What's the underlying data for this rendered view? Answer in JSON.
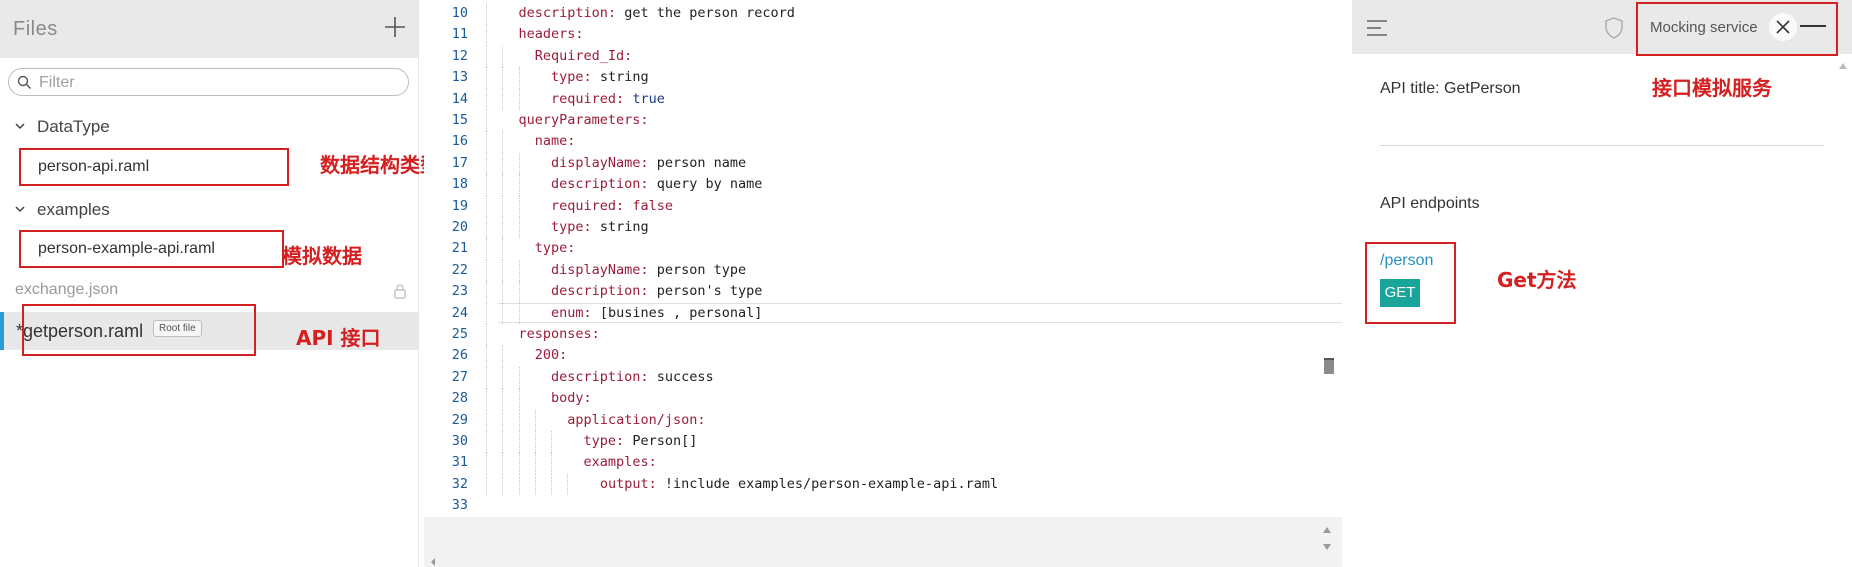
{
  "files_panel": {
    "title": "Files",
    "filter_placeholder": "Filter",
    "folders": [
      {
        "name": "DataType",
        "files": [
          "person-api.raml"
        ]
      },
      {
        "name": "examples",
        "files": [
          "person-example-api.raml"
        ]
      }
    ],
    "exchange_file": "exchange.json",
    "active_file": "*getperson.raml",
    "root_badge": "Root file"
  },
  "annotations": {
    "datatype": "数据结构类型",
    "mock_data": "模拟数据",
    "api": "API 接口",
    "mocking": "接口模拟服务",
    "get_method": "Get方法"
  },
  "editor": {
    "lines": [
      {
        "n": "10",
        "indent": 2,
        "parts": [
          [
            "k",
            "description: "
          ],
          [
            "t",
            "get the person record"
          ]
        ]
      },
      {
        "n": "11",
        "indent": 2,
        "parts": [
          [
            "k",
            "headers:"
          ]
        ]
      },
      {
        "n": "12",
        "indent": 3,
        "parts": [
          [
            "k",
            "Required_Id:"
          ]
        ]
      },
      {
        "n": "13",
        "indent": 4,
        "parts": [
          [
            "k",
            "type: "
          ],
          [
            "t",
            "string"
          ]
        ]
      },
      {
        "n": "14",
        "indent": 4,
        "parts": [
          [
            "k",
            "required: "
          ],
          [
            "b",
            "true"
          ]
        ]
      },
      {
        "n": "15",
        "indent": 2,
        "parts": [
          [
            "k",
            "queryParameters:"
          ]
        ]
      },
      {
        "n": "16",
        "indent": 3,
        "parts": [
          [
            "k",
            "name:"
          ]
        ]
      },
      {
        "n": "17",
        "indent": 4,
        "parts": [
          [
            "k",
            "displayName: "
          ],
          [
            "t",
            "person name"
          ]
        ]
      },
      {
        "n": "18",
        "indent": 4,
        "parts": [
          [
            "k",
            "description: "
          ],
          [
            "t",
            "query by name"
          ]
        ]
      },
      {
        "n": "19",
        "indent": 4,
        "parts": [
          [
            "k",
            "required: "
          ],
          [
            "f",
            "false"
          ]
        ]
      },
      {
        "n": "20",
        "indent": 4,
        "parts": [
          [
            "k",
            "type: "
          ],
          [
            "t",
            "string"
          ]
        ]
      },
      {
        "n": "21",
        "indent": 3,
        "parts": [
          [
            "k",
            "type:"
          ]
        ]
      },
      {
        "n": "22",
        "indent": 4,
        "parts": [
          [
            "k",
            "displayName: "
          ],
          [
            "t",
            "person type"
          ]
        ]
      },
      {
        "n": "23",
        "indent": 4,
        "parts": [
          [
            "k",
            "description: "
          ],
          [
            "t",
            "person's type"
          ]
        ]
      },
      {
        "n": "24",
        "indent": 4,
        "parts": [
          [
            "k",
            "enum: "
          ],
          [
            "t",
            "[busines , personal]"
          ]
        ]
      },
      {
        "n": "25",
        "indent": 2,
        "parts": [
          [
            "k",
            "responses:"
          ]
        ]
      },
      {
        "n": "26",
        "indent": 3,
        "parts": [
          [
            "k",
            "200:"
          ]
        ]
      },
      {
        "n": "27",
        "indent": 4,
        "parts": [
          [
            "k",
            "description: "
          ],
          [
            "t",
            "success"
          ]
        ]
      },
      {
        "n": "28",
        "indent": 4,
        "parts": [
          [
            "k",
            "body:"
          ]
        ]
      },
      {
        "n": "29",
        "indent": 5,
        "parts": [
          [
            "k",
            "application/json:"
          ]
        ]
      },
      {
        "n": "30",
        "indent": 6,
        "parts": [
          [
            "k",
            "type: "
          ],
          [
            "t",
            "Person[]"
          ]
        ]
      },
      {
        "n": "31",
        "indent": 6,
        "parts": [
          [
            "k",
            "examples:"
          ]
        ]
      },
      {
        "n": "32",
        "indent": 7,
        "parts": [
          [
            "k",
            "output: "
          ],
          [
            "i",
            "!include "
          ],
          [
            "t",
            "examples/person-example-api.raml"
          ]
        ]
      },
      {
        "n": "33",
        "indent": 0,
        "parts": []
      }
    ]
  },
  "right_panel": {
    "mocking_label": "Mocking service",
    "api_title": "API title: GetPerson",
    "endpoints_label": "API endpoints",
    "endpoint": "/person",
    "method": "GET"
  },
  "colors": {
    "accent": "#2a9bd4",
    "method_badge": "#1aa59a",
    "annotation": "#d42020"
  }
}
